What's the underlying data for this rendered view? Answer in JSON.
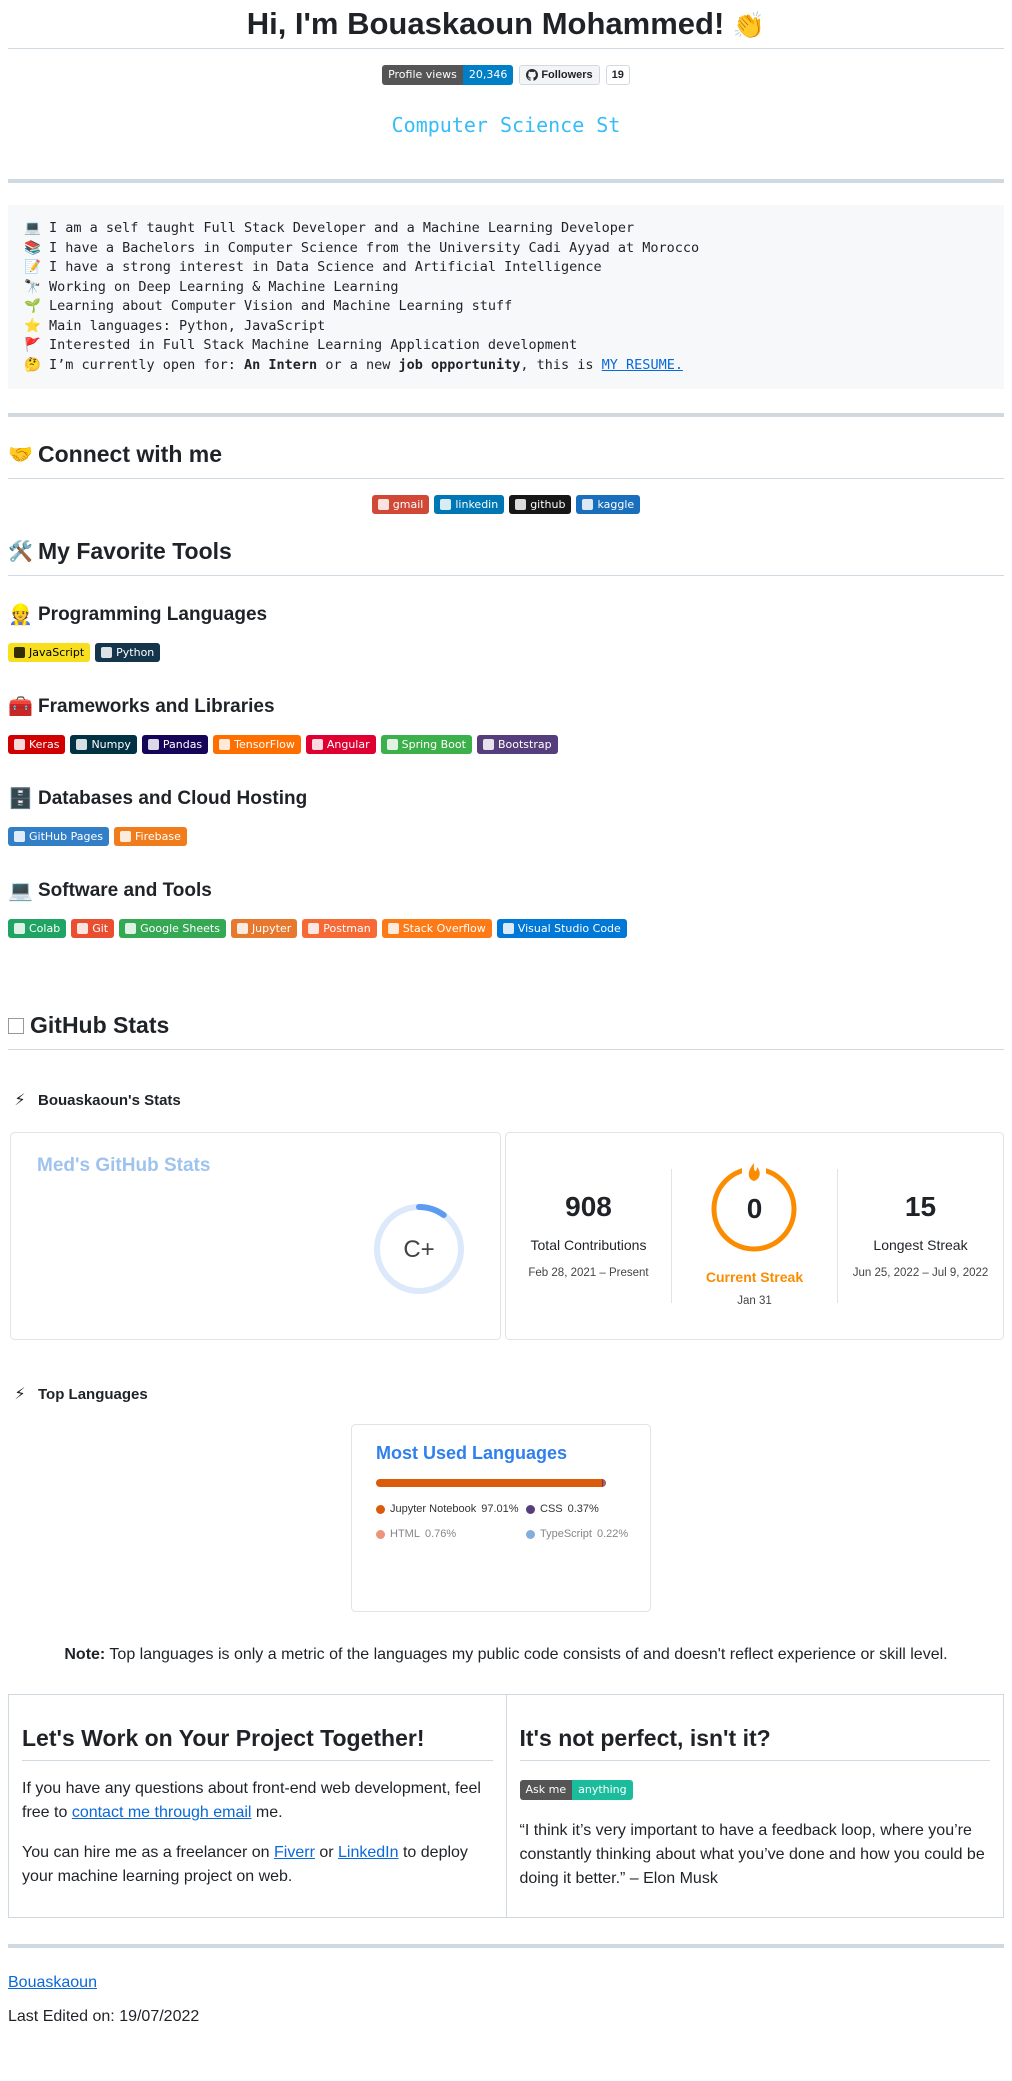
{
  "header": {
    "title": "Hi, I'm Bouaskaoun Mohammed!",
    "wave_emoji": "👏",
    "profile_views_label": "Profile views",
    "profile_views_value": "20,346",
    "followers_label": "Followers",
    "followers_count": "19",
    "typing_text": "Computer Science St"
  },
  "about": {
    "lines": [
      {
        "emoji": "💻",
        "text": "I am a self taught Full Stack Developer and a Machine Learning Developer"
      },
      {
        "emoji": "📚",
        "text": "I have a Bachelors in Computer Science from the University Cadi Ayyad at Morocco"
      },
      {
        "emoji": "📝",
        "text": "I have a strong interest in Data Science and Artificial Intelligence"
      },
      {
        "emoji": "🔭",
        "text": "Working on Deep Learning & Machine Learning"
      },
      {
        "emoji": "🌱",
        "text": "Learning about Computer Vision and Machine Learning stuff"
      },
      {
        "emoji": "⭐",
        "text": "Main languages: Python, JavaScript"
      },
      {
        "emoji": "🚩",
        "text": "Interested in Full Stack Machine Learning Application development"
      }
    ],
    "last_line": {
      "emoji": "🤔",
      "pre": "I’m currently open for: ",
      "intern": "An Intern",
      "mid": " or a new ",
      "job": "job opportunity",
      "post": ", this is ",
      "resume": "MY RESUME."
    }
  },
  "connect": {
    "title": "Connect with me",
    "emoji": "🤝",
    "badges": [
      {
        "label": "gmail",
        "color": "#d14836"
      },
      {
        "label": "linkedin",
        "color": "#0077b5"
      },
      {
        "label": "github",
        "color": "#181717"
      },
      {
        "label": "kaggle",
        "color": "#1a6fbd"
      }
    ]
  },
  "tools": {
    "title": "My Favorite Tools",
    "emoji": "🛠️",
    "groups": [
      {
        "title": "Programming Languages",
        "emoji": "👷",
        "badges": [
          {
            "label": "JavaScript",
            "color": "#f7df1e",
            "text": "#000000"
          },
          {
            "label": "Python",
            "color": "#14354c",
            "text": "#ffffff"
          }
        ]
      },
      {
        "title": "Frameworks and Libraries",
        "emoji": "🧰",
        "badges": [
          {
            "label": "Keras",
            "color": "#d00000",
            "text": "#ffffff"
          },
          {
            "label": "Numpy",
            "color": "#013243",
            "text": "#ffffff"
          },
          {
            "label": "Pandas",
            "color": "#150458",
            "text": "#ffffff"
          },
          {
            "label": "TensorFlow",
            "color": "#ff6f00",
            "text": "#ffffff"
          },
          {
            "label": "Angular",
            "color": "#dd0031",
            "text": "#ffffff"
          },
          {
            "label": "Spring Boot",
            "color": "#3cb04a",
            "text": "#ffffff"
          },
          {
            "label": "Bootstrap",
            "color": "#563d7c",
            "text": "#ffffff"
          }
        ]
      },
      {
        "title": "Databases and Cloud Hosting",
        "emoji": "🗄️",
        "badges": [
          {
            "label": "GitHub Pages",
            "color": "#327fc7",
            "text": "#ffffff"
          },
          {
            "label": "Firebase",
            "color": "#f17c1c",
            "text": "#ffffff"
          }
        ]
      },
      {
        "title": "Software and Tools",
        "emoji": "💻",
        "badges": [
          {
            "label": "Colab",
            "color": "#1fa463",
            "text": "#ffffff"
          },
          {
            "label": "Git",
            "color": "#e94e31",
            "text": "#ffffff"
          },
          {
            "label": "Google Sheets",
            "color": "#34a853",
            "text": "#ffffff"
          },
          {
            "label": "Jupyter",
            "color": "#e6792e",
            "text": "#ffffff"
          },
          {
            "label": "Postman",
            "color": "#f76935",
            "text": "#ffffff"
          },
          {
            "label": "Stack Overflow",
            "color": "#fe7a16",
            "text": "#ffffff"
          },
          {
            "label": "Visual Studio Code",
            "color": "#0078d7",
            "text": "#ffffff"
          }
        ]
      }
    ]
  },
  "github_stats": {
    "title": "GitHub Stats",
    "stats_heading": "Bouaskaoun's Stats",
    "stats_card_title": "Med's GitHub Stats",
    "grade": "C+",
    "grade_progress": 0.1,
    "streak": {
      "total": "908",
      "total_label": "Total Contributions",
      "total_range": "Feb 28, 2021 – Present",
      "current": "0",
      "current_label": "Current Streak",
      "current_date": "Jan 31",
      "longest": "15",
      "longest_label": "Longest Streak",
      "longest_range": "Jun 25, 2022 – Jul 9, 2022"
    },
    "top_langs_heading": "Top Languages",
    "langs_card_title": "Most Used Languages",
    "languages": [
      {
        "name": "Jupyter Notebook",
        "pct": "97.01%",
        "value": 97.01,
        "color": "#da5b0b"
      },
      {
        "name": "CSS",
        "pct": "0.37%",
        "value": 0.37,
        "color": "#563d7c"
      },
      {
        "name": "HTML",
        "pct": "0.76%",
        "value": 0.76,
        "color": "#e34c26"
      },
      {
        "name": "TypeScript",
        "pct": "0.22%",
        "value": 0.22,
        "color": "#3178c6"
      }
    ],
    "note_bold": "Note:",
    "note_text": " Top languages is only a metric of the languages my public code consists of and doesn't reflect experience or skill level."
  },
  "work": {
    "left_title": "Let's Work on Your Project Together!",
    "left_p1_pre": "If you have any questions about front-end web development, feel free to ",
    "left_p1_link": "contact me through email",
    "left_p1_post": " me.",
    "left_p2_pre": "You can hire me as a freelancer on ",
    "left_p2_link1": "Fiverr",
    "left_p2_mid": " or ",
    "left_p2_link2": "LinkedIn",
    "left_p2_post": " to deploy your machine learning project on web.",
    "right_title": "It's not perfect, isn't it?",
    "ask_left": "Ask me",
    "ask_right": "anything",
    "quote": "“I think it’s very important to have a feedback loop, where you’re constantly thinking about what you’ve done and how you could be doing it better.” – Elon Musk"
  },
  "footer": {
    "link": "Bouaskaoun",
    "last_edited": "Last Edited on: 19/07/2022"
  }
}
